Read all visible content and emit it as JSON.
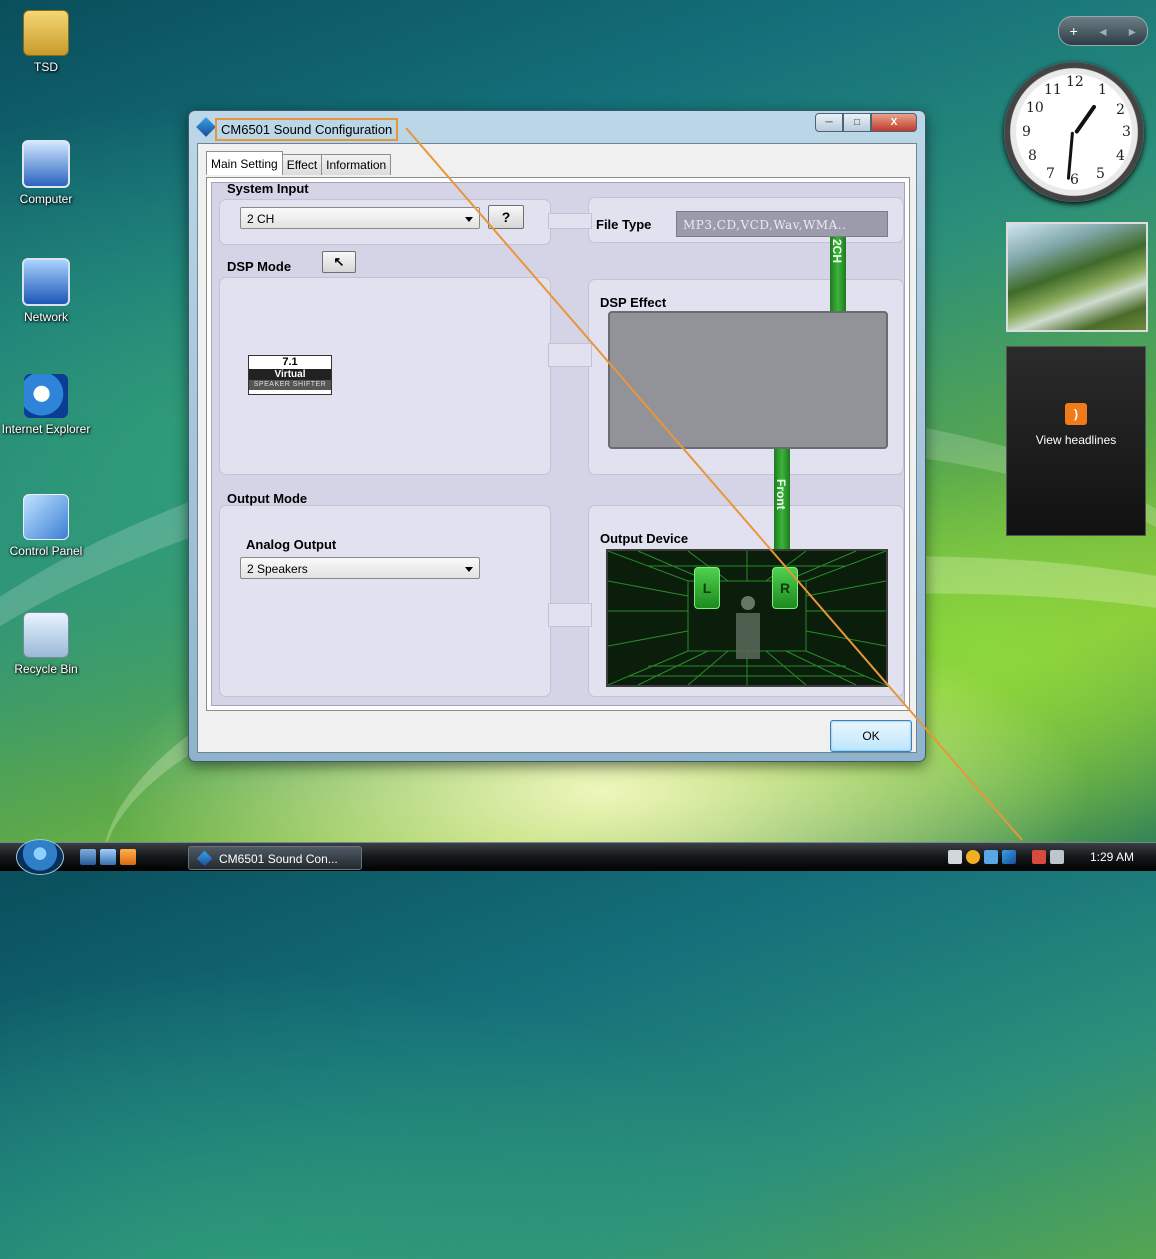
{
  "desktop": {
    "icons": [
      {
        "label": "TSD"
      },
      {
        "label": "Computer"
      },
      {
        "label": "Network"
      },
      {
        "label": "Internet Explorer"
      },
      {
        "label": "Control Panel"
      },
      {
        "label": "Recycle Bin"
      }
    ]
  },
  "sidebar": {
    "controls": {
      "add": "+",
      "prev": "◂",
      "next": "▸"
    },
    "clock_numbers": [
      "12",
      "1",
      "2",
      "3",
      "4",
      "5",
      "6",
      "7",
      "8",
      "9",
      "10",
      "11"
    ],
    "feed_label": "View headlines"
  },
  "window": {
    "title": "CM6501 Sound Configuration",
    "tabs": [
      "Main Setting",
      "Effect",
      "Information"
    ],
    "active_tab": "Main Setting",
    "system_input": {
      "label": "System Input",
      "value": "2 CH",
      "help": "?"
    },
    "file_type": {
      "label": "File Type",
      "value": "MP3,CD,VCD,Wav,WMA.."
    },
    "dsp_mode": {
      "label": "DSP Mode",
      "button": "↖"
    },
    "vss_logo": {
      "line1": "7.1",
      "line2": "Virtual",
      "line3": "SPEAKER SHIFTER"
    },
    "dsp_effect": {
      "label": "DSP Effect"
    },
    "channel_2ch": "2CH",
    "channel_front": "Front",
    "output_mode": {
      "label": "Output Mode",
      "sub_label": "Analog Output",
      "value": "2 Speakers"
    },
    "output_device": {
      "label": "Output Device",
      "left": "L",
      "right": "R"
    },
    "ok": "OK"
  },
  "taskbar": {
    "task_label": "CM6501 Sound Con...",
    "clock": "1:29 AM"
  },
  "colors": {
    "annotation_line": "#e8963a",
    "channel_green": "#2e9a2e",
    "panel_bg": "#d4d4e6"
  }
}
